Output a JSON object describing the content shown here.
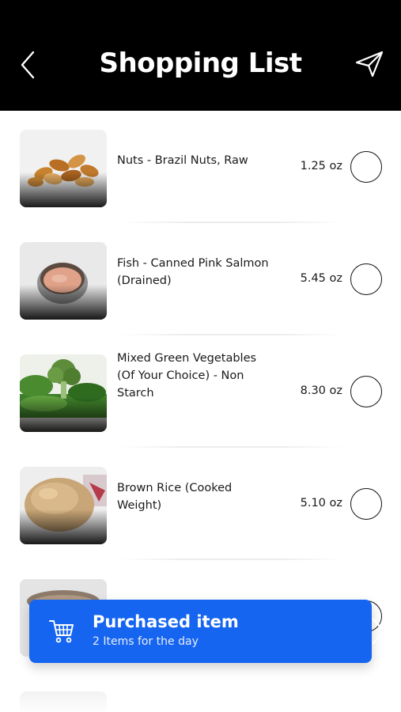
{
  "header": {
    "title": "Shopping List",
    "back_icon": "chevron-left-icon",
    "share_icon": "paper-plane-icon"
  },
  "items": [
    {
      "name": "Nuts - Brazil Nuts, Raw",
      "qty": "1.25 oz",
      "image": "brazil-nuts"
    },
    {
      "name": "Fish - Canned Pink Salmon (Drained)",
      "qty": "5.45 oz",
      "image": "canned-salmon"
    },
    {
      "name": "Mixed Green Vegetables (Of Your Choice) - Non Starch",
      "qty": "8.30 oz",
      "image": "green-vegetables"
    },
    {
      "name": "Brown Rice (Cooked Weight)",
      "qty": "5.10 oz",
      "image": "brown-rice"
    },
    {
      "name": "",
      "qty": "",
      "image": "partially-hidden"
    }
  ],
  "purchased": {
    "title": "Purchased item",
    "subtitle": "2 Items for the day",
    "icon": "cart-icon"
  },
  "colors": {
    "header_bg": "#000000",
    "accent": "#1565f0"
  }
}
